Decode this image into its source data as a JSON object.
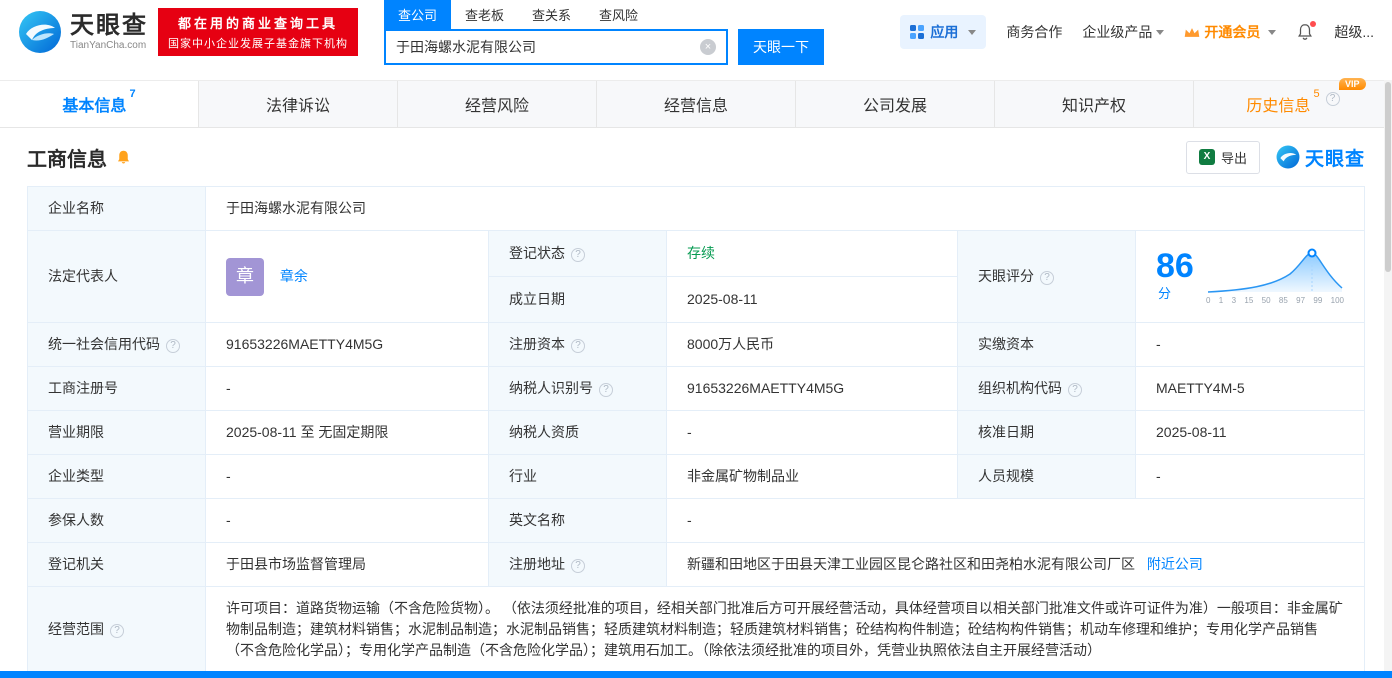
{
  "colors": {
    "accent": "#0084ff",
    "brand_red": "#e60012",
    "status_green": "#079b52",
    "vip_orange": "#ff8a00"
  },
  "header": {
    "logo_title": "天眼查",
    "logo_domain": "TianYanCha.com",
    "banner_line1": "都在用的商业查询工具",
    "banner_line2": "国家中小企业发展子基金旗下机构",
    "search_tabs": [
      {
        "label": "查公司"
      },
      {
        "label": "查老板"
      },
      {
        "label": "查关系"
      },
      {
        "label": "查风险"
      }
    ],
    "search_value": "于田海螺水泥有限公司",
    "search_button": "天眼一下",
    "app_label": "应用",
    "nav_biz": "商务合作",
    "nav_enterprise": "企业级产品",
    "nav_member": "开通会员",
    "nav_super": "超级..."
  },
  "tabs": [
    {
      "label": "基本信息",
      "badge": "7"
    },
    {
      "label": "法律诉讼"
    },
    {
      "label": "经营风险"
    },
    {
      "label": "经营信息"
    },
    {
      "label": "公司发展"
    },
    {
      "label": "知识产权"
    },
    {
      "label": "历史信息",
      "badge": "5",
      "vip": "VIP"
    }
  ],
  "section": {
    "title": "工商信息",
    "export_label": "导出",
    "watermark": "天眼查"
  },
  "company": {
    "name_label": "企业名称",
    "name": "于田海螺水泥有限公司",
    "legal_rep_label": "法定代表人",
    "legal_rep_avatar": "章",
    "legal_rep_name": "章余",
    "reg_status_label": "登记状态",
    "reg_status": "存续",
    "score_label": "天眼评分",
    "score_value": "86",
    "score_unit": "分",
    "score_ticks": [
      "0",
      "1",
      "3",
      "15",
      "50",
      "85",
      "97",
      "99",
      "100"
    ],
    "established_label": "成立日期",
    "established": "2025-08-11",
    "credit_code_label": "统一社会信用代码",
    "credit_code": "91653226MAETTY4M5G",
    "reg_capital_label": "注册资本",
    "reg_capital": "8000万人民币",
    "paid_capital_label": "实缴资本",
    "paid_capital": "-",
    "reg_number_label": "工商注册号",
    "reg_number": "-",
    "taxpayer_id_label": "纳税人识别号",
    "taxpayer_id": "91653226MAETTY4M5G",
    "org_code_label": "组织机构代码",
    "org_code": "MAETTY4M-5",
    "business_term_label": "营业期限",
    "business_term": "2025-08-11 至 无固定期限",
    "taxpayer_quality_label": "纳税人资质",
    "taxpayer_quality": "-",
    "approval_date_label": "核准日期",
    "approval_date": "2025-08-11",
    "company_type_label": "企业类型",
    "company_type": "-",
    "industry_label": "行业",
    "industry": "非金属矿物制品业",
    "staff_size_label": "人员规模",
    "staff_size": "-",
    "insured_label": "参保人数",
    "insured": "-",
    "english_name_label": "英文名称",
    "english_name": "-",
    "registry_label": "登记机关",
    "registry": "于田县市场监督管理局",
    "address_label": "注册地址",
    "address": "新疆和田地区于田县天津工业园区昆仑路社区和田尧柏水泥有限公司厂区",
    "nearby_link": "附近公司",
    "scope_label": "经营范围",
    "scope": "许可项目：道路货物运输（不含危险货物）。 （依法须经批准的项目，经相关部门批准后方可开展经营活动，具体经营项目以相关部门批准文件或许可证件为准）一般项目：非金属矿物制品制造；建筑材料销售；水泥制品制造；水泥制品销售；轻质建筑材料制造；轻质建筑材料销售；砼结构构件制造；砼结构构件销售；机动车修理和维护；专用化学产品销售（不含危险化学品）；专用化学产品制造（不含危险化学品）；建筑用石加工。（除依法须经批准的项目外，凭营业执照依法自主开展经营活动）"
  }
}
